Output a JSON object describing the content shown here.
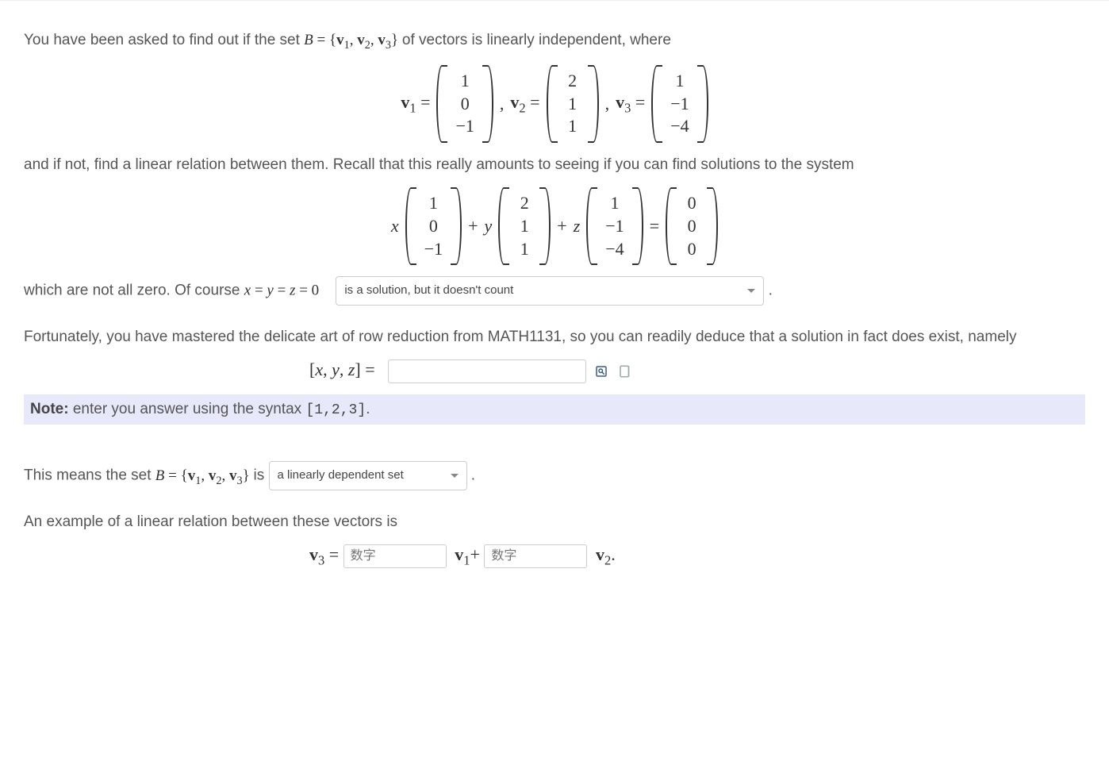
{
  "intro": {
    "line1_pre": "You have been asked to find out if the set ",
    "set_expr": "B = {v₁, v₂, v₃}",
    "line1_post": " of vectors is linearly independent, where"
  },
  "vectors": {
    "v1_label": "v",
    "v1_sub": "1",
    "v2_label": "v",
    "v2_sub": "2",
    "v3_label": "v",
    "v3_sub": "3",
    "equals": " = ",
    "comma": " ,     ",
    "v1": [
      "1",
      "0",
      "−1"
    ],
    "v2": [
      "2",
      "1",
      "1"
    ],
    "v3": [
      "1",
      "−1",
      "−4"
    ]
  },
  "para2": "and if not, find a linear relation between them. Recall that this really amounts to seeing if you can find solutions to the system",
  "system": {
    "x": "x",
    "y": "y",
    "z": "z",
    "plus": " + ",
    "eq": " = ",
    "v1": [
      "1",
      "0",
      "−1"
    ],
    "v2": [
      "2",
      "1",
      "1"
    ],
    "v3": [
      "1",
      "−1",
      "−4"
    ],
    "zero": [
      "0",
      "0",
      "0"
    ]
  },
  "para3_pre": "which are not all zero. Of course ",
  "trivial_eq": "x = y = z = 0",
  "dropdown1": "is a solution, but it doesn't count",
  "period": " .",
  "para4": "Fortunately, you have mastered the delicate art of row reduction from MATH1131, so you can readily deduce that a solution in fact does exist, namely",
  "xyz_lhs": "[x, y, z] = ",
  "answer_value": "",
  "note_label": "Note:",
  "note_text": " enter you answer using the syntax ",
  "note_syntax": "[1,2,3]",
  "note_period": ".",
  "para5_pre": "This means the set ",
  "para5_post": " is ",
  "dropdown2": "a linearly dependent set",
  "para6": "An example of a linear relation between these vectors is",
  "rel": {
    "v3l": "v",
    "v3s": "3",
    "eq": " = ",
    "ph": "数字",
    "v1l": "v",
    "v1s": "1",
    "plus": "+ ",
    "v2l": "v",
    "v2s": "2",
    "period": "."
  }
}
